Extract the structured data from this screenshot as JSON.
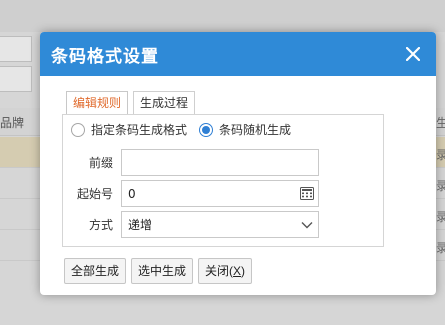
{
  "background": {
    "column_header": "品牌",
    "right_header": "生",
    "right_rows": [
      "录",
      "录",
      "录",
      "录"
    ]
  },
  "dialog": {
    "title": "条码格式设置",
    "tabs": [
      {
        "label": "编辑规则",
        "active": true
      },
      {
        "label": "生成过程",
        "active": false
      }
    ],
    "radio_options": [
      {
        "label": "指定条码生成格式",
        "checked": false
      },
      {
        "label": "条码随机生成",
        "checked": true
      }
    ],
    "fields": {
      "prefix": {
        "label": "前缀",
        "value": ""
      },
      "start_number": {
        "label": "起始号",
        "value": "0"
      },
      "mode": {
        "label": "方式",
        "value": "递增"
      }
    },
    "buttons": {
      "generate_all": "全部生成",
      "generate_selected": "选中生成",
      "close_prefix": "关闭(",
      "close_key": "X",
      "close_suffix": ")"
    }
  },
  "colors": {
    "header_bg": "#2f8ad7",
    "active_tab_text": "#e06a2c",
    "radio_checked": "#2f7fd4",
    "highlight_row": "#d5ccb1"
  }
}
